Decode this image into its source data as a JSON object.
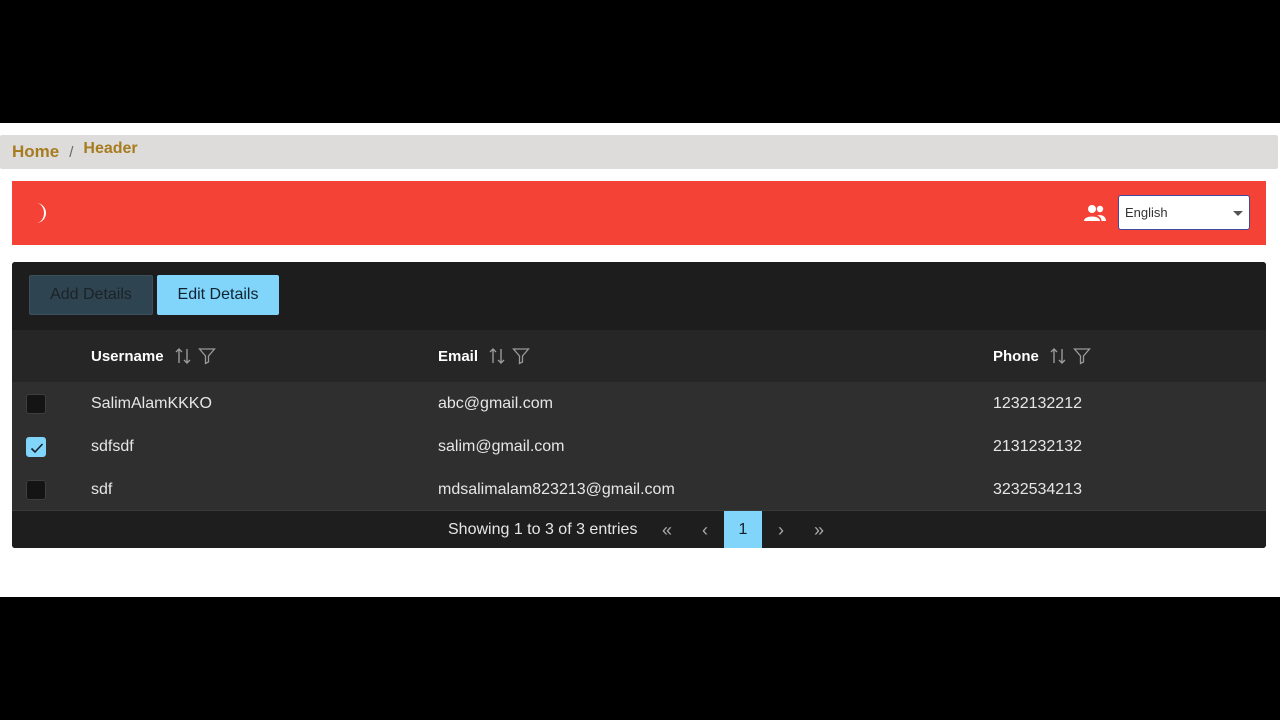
{
  "breadcrumb": {
    "home": "Home",
    "separator": "/",
    "current": "Header"
  },
  "topbar": {
    "theme_icon": "moon-icon",
    "users_icon": "users-icon",
    "language": {
      "selected": "English"
    }
  },
  "toolbar": {
    "add_label": "Add Details",
    "edit_label": "Edit Details"
  },
  "table": {
    "columns": [
      {
        "label": "Username"
      },
      {
        "label": "Email"
      },
      {
        "label": "Phone"
      }
    ],
    "rows": [
      {
        "checked": false,
        "username": "SalimAlamKKKO",
        "email": "abc@gmail.com",
        "phone": "1232132212"
      },
      {
        "checked": true,
        "username": "sdfsdf",
        "email": "salim@gmail.com",
        "phone": "2131232132"
      },
      {
        "checked": false,
        "username": "sdf",
        "email": "mdsalimalam823213@gmail.com",
        "phone": "3232534213"
      }
    ]
  },
  "pagination": {
    "summary": "Showing 1 to 3 of 3 entries",
    "first": "«",
    "prev": "‹",
    "current_page": "1",
    "next": "›",
    "last": "»"
  },
  "colors": {
    "topbar": "#f44336",
    "accent": "#81d4fa",
    "breadcrumb_text": "#a67c1f",
    "panel": "#1e1e1e"
  }
}
